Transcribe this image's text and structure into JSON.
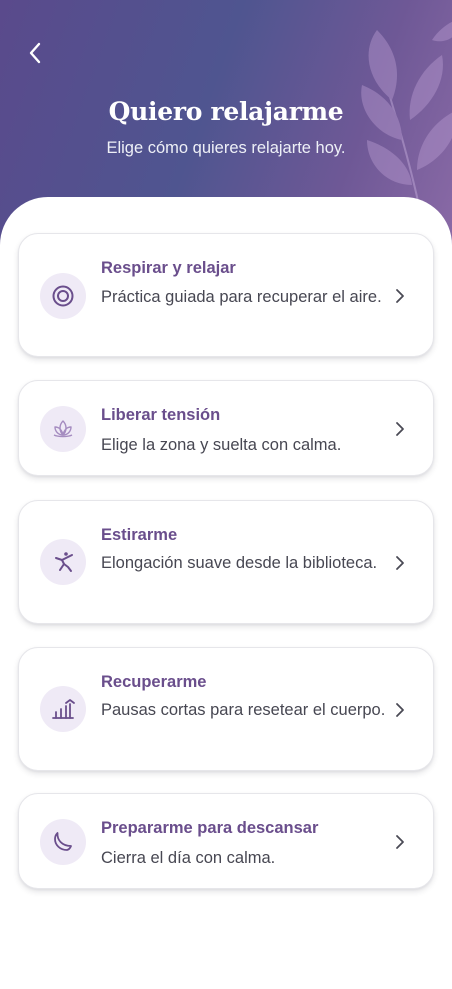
{
  "header": {
    "title": "Quiero relajarme",
    "subtitle": "Elige cómo quieres relajarte hoy."
  },
  "options": [
    {
      "title": "Respirar y relajar",
      "description": "Práctica guiada para recuperar el aire.",
      "icon": "target-icon"
    },
    {
      "title": "Liberar tensión",
      "description": "Elige la zona y suelta con calma.",
      "icon": "lotus-icon"
    },
    {
      "title": "Estirarme",
      "description": "Elongación suave desde la biblioteca.",
      "icon": "stretch-figure-icon"
    },
    {
      "title": "Recuperarme",
      "description": "Pausas cortas para resetear el cuerpo.",
      "icon": "progress-chart-icon"
    },
    {
      "title": "Prepararme para descansar",
      "description": "Cierra el día con calma.",
      "icon": "moon-icon"
    }
  ],
  "colors": {
    "header_gradient_start": "#5a4a8c",
    "header_gradient_end": "#8a6aa6",
    "accent": "#6a4e8c",
    "icon_bg": "#efeaf6",
    "body_text": "#474752"
  }
}
